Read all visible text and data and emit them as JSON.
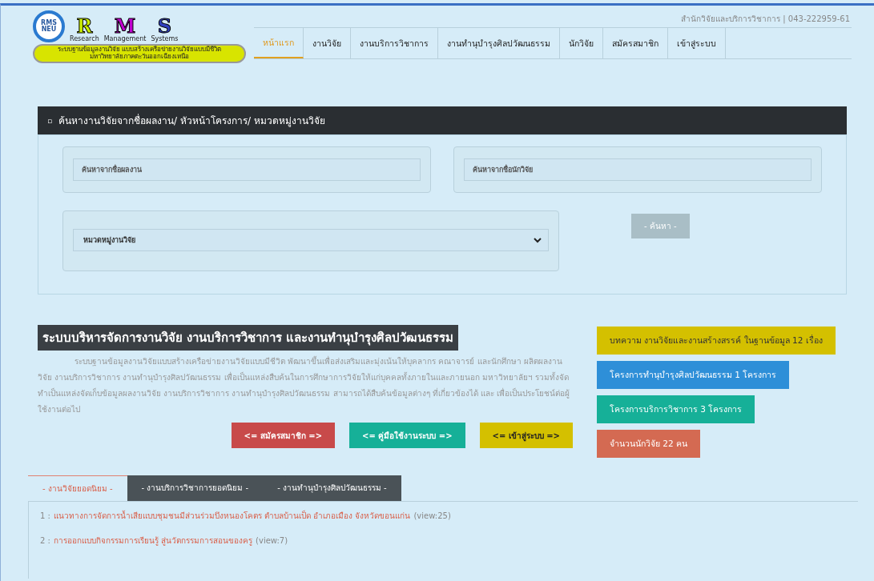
{
  "logo": {
    "circle_text": [
      "RMS",
      "NEU"
    ],
    "letters": [
      {
        "letter": "R",
        "word": "Research",
        "color": "#ccf000"
      },
      {
        "letter": "M",
        "word": "Management",
        "color": "#c000d0"
      },
      {
        "letter": "S",
        "word": "Systems",
        "color": "#3040c0"
      }
    ],
    "tagline": [
      "ระบบฐานข้อมูลงานวิจัย แบบสร้างเครือข่ายงานวิจัยแบบมีชีวิต",
      "มหาวิทยาลัยภาคตะวันออกเฉียงเหนือ"
    ]
  },
  "contact": "สำนักวิจัยและบริการวิชาการ | 043-222959-61",
  "nav": [
    {
      "label": "หน้าแรก",
      "selected": true
    },
    {
      "label": "งานวิจัย",
      "selected": false
    },
    {
      "label": "งานบริการวิชาการ",
      "selected": false
    },
    {
      "label": "งานทำนุบำรุงศิลปวัฒนธรรม",
      "selected": false
    },
    {
      "label": "นักวิจัย",
      "selected": false
    },
    {
      "label": "สมัครสมาชิก",
      "selected": false
    },
    {
      "label": "เข้าสู่ระบบ",
      "selected": false
    }
  ],
  "search": {
    "title": "ค้นหางานวิจัยจากชื่อผลงาน/ หัวหน้าโครงการ/ หมวดหมู่งานวิจัย",
    "title_icon": "▫",
    "work_placeholder": "ค้นหาจากชื่อผลงาน",
    "researcher_placeholder": "ค้นหาจากชื่อนักวิจัย",
    "category": "หมวดหมู่งานวิจัย",
    "button": "- ค้นหา -"
  },
  "intro": {
    "title": "ระบบบริหารจัดการงานวิจัย งานบริการวิชาการ และงานทำนุบำรุงศิลปวัฒนธรรม",
    "text": "ระบบฐานข้อมูลงานวิจัยแบบสร้างเครือข่ายงานวิจัยแบบมีชีวิต พัฒนาขึ้นเพื่อส่งเสริมและมุ่งเน้นให้บุคลากร คณาจารย์ และนักศึกษา ผลิตผลงานวิจัย งานบริการวิชาการ งานทำนุบำรุงศิลปวัฒนธรรม เพื่อเป็นแหล่งสืบค้นในการศึกษาการวิจัยให้แก่บุคคลทั้งภายในและภายนอก มหาวิทยาลัยฯ รวมทั้งจัดทำเป็นแหล่งจัดเก็บข้อมูลผลงานวิจัย งานบริการวิชาการ งานทำนุบำรุงศิลปวัฒนธรรม สามารถได้สืบค้นข้อมูลต่างๆ ที่เกี่ยวข้องได้ และ เพื่อเป็นประโยชน์ต่อผู้ใช้งานต่อไป",
    "buttons": [
      {
        "label": "<= สมัครสมาชิก =>",
        "color": "#c84a4a"
      },
      {
        "label": "<= คู่มือใช้งานระบบ =>",
        "color": "#16b098"
      },
      {
        "label": "<= เข้าสู่ระบบ =>",
        "color": "#d4c000"
      }
    ]
  },
  "stats": [
    {
      "label": "บทความ งานวิจัยและงานสร้างสรรค์ ในฐานข้อมูล 12 เรื่อง",
      "color": "#d4c000"
    },
    {
      "label": "โครงการทำนุบำรุงศิลปวัฒนธรรม 1 โครงการ",
      "color": "#2e8fd8"
    },
    {
      "label": "โครงการบริการวิชาการ 3 โครงการ",
      "color": "#16b098"
    },
    {
      "label": "จำนวนนักวิจัย 22 คน",
      "color": "#d46a52"
    }
  ],
  "tabs": [
    {
      "label": "- งานวิจัยยอดนิยม -",
      "selected": true
    },
    {
      "label": "- งานบริการวิชาการยอดนิยม -",
      "selected": false
    },
    {
      "label": "- งานทำนุบำรุงศิลปวัฒนธรรม -",
      "selected": false
    }
  ],
  "popular": [
    {
      "number": "1 :",
      "title": "แนวทางการจัดการน้ำเสียแบบชุมชนมีส่วนร่วมบึงหนองโคตร ตำบลบ้านเป็ด อำเภอเมือง จังหวัดขอนแก่น",
      "views": "(view:25)"
    },
    {
      "number": "2 :",
      "title": "การออกแบบกิจกรรมการเรียนรู้ สู่นวัตกรรมการสอนของครู",
      "views": "(view:7)"
    }
  ]
}
